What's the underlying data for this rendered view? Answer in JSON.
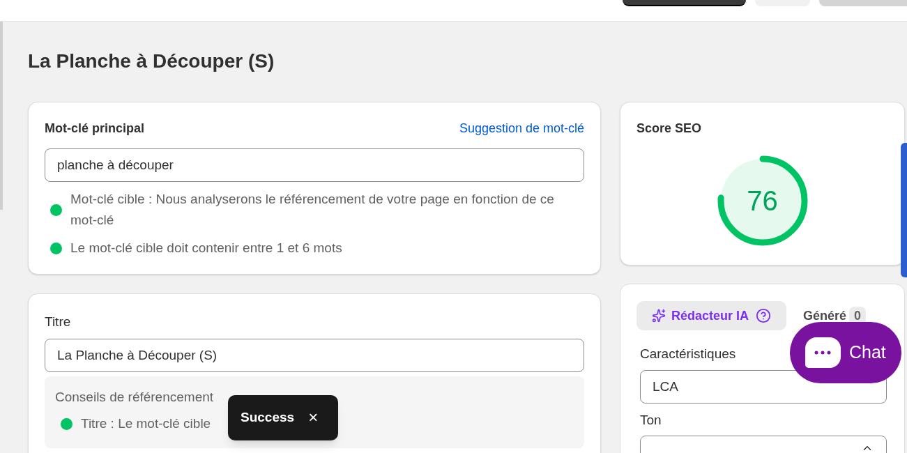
{
  "page_title": "La Planche à Découper (S)",
  "keyword_card": {
    "label": "Mot-clé principal",
    "link": "Suggestion de mot-clé",
    "value": "planche à découper",
    "hints": [
      {
        "text": "Mot-clé cible : Nous analyserons le référencement de votre page en fonction de ce mot-clé",
        "color": "#00c364"
      },
      {
        "text": "Le mot-clé cible doit contenir entre 1 et 6 mots",
        "color": "#00c364"
      }
    ]
  },
  "title_card": {
    "label": "Titre",
    "value": "La Planche à Découper (S)",
    "tips_heading": "Conseils de référencement",
    "tips": [
      {
        "text": "Titre : Le mot-clé cible",
        "color": "#00c364"
      }
    ]
  },
  "seo_score": {
    "label": "Score SEO",
    "value": "76",
    "level": 0.76
  },
  "ai_card": {
    "button": "Rédacteur IA",
    "generated_label": "Généré",
    "generated_count": "0",
    "fields": [
      {
        "kind": "text",
        "label": "Caractéristiques",
        "value": "LCA"
      },
      {
        "kind": "select",
        "label": "Ton",
        "expanded": true
      }
    ]
  },
  "toast": {
    "text": "Success",
    "close": "×"
  },
  "chat_button": {
    "label": "Chat"
  }
}
